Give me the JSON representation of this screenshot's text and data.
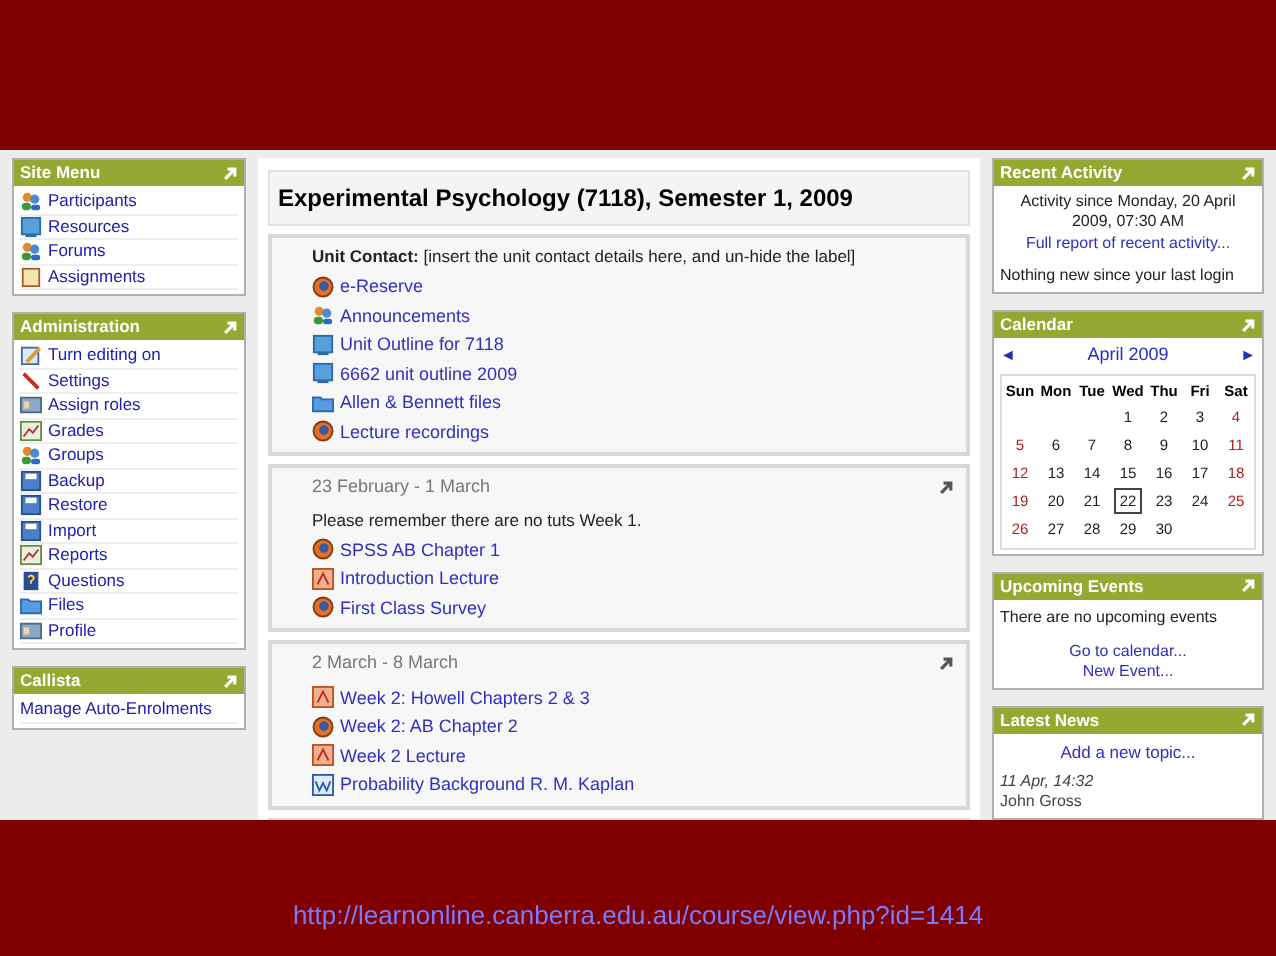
{
  "left_blocks": [
    {
      "title": "Site Menu",
      "items": [
        {
          "label": "Participants",
          "kind": "people"
        },
        {
          "label": "Resources",
          "kind": "page"
        },
        {
          "label": "Forums",
          "kind": "people"
        },
        {
          "label": "Assignments",
          "kind": "clipboard"
        }
      ]
    },
    {
      "title": "Administration",
      "items": [
        {
          "label": "Turn editing on",
          "kind": "edit"
        },
        {
          "label": "Settings",
          "kind": "pen"
        },
        {
          "label": "Assign roles",
          "kind": "card"
        },
        {
          "label": "Grades",
          "kind": "chart"
        },
        {
          "label": "Groups",
          "kind": "people"
        },
        {
          "label": "Backup",
          "kind": "disk"
        },
        {
          "label": "Restore",
          "kind": "disk"
        },
        {
          "label": "Import",
          "kind": "disk"
        },
        {
          "label": "Reports",
          "kind": "chart"
        },
        {
          "label": "Questions",
          "kind": "question"
        },
        {
          "label": "Files",
          "kind": "folder"
        },
        {
          "label": "Profile",
          "kind": "card"
        }
      ]
    },
    {
      "title": "Callista",
      "items": [
        {
          "label": "Manage Auto-Enrolments"
        }
      ]
    }
  ],
  "course_title": "Experimental Psychology (7118), Semester 1, 2009",
  "sections": [
    {
      "note": "**Unit Contact:** [insert the unit contact details here, and un-hide the label]",
      "items": [
        {
          "label": "e-Reserve",
          "kind": "globe"
        },
        {
          "label": "Announcements",
          "kind": "people"
        },
        {
          "label": "Unit Outline for 7118",
          "kind": "page"
        },
        {
          "label": "6662 unit outline 2009",
          "kind": "page"
        },
        {
          "label": "Allen & Bennett files",
          "kind": "folder"
        },
        {
          "label": "Lecture recordings",
          "kind": "globe"
        }
      ]
    },
    {
      "heading": "23 February - 1 March",
      "note": "Please remember there are no tuts Week 1.",
      "items": [
        {
          "label": "SPSS AB Chapter 1",
          "kind": "globe"
        },
        {
          "label": "Introduction Lecture",
          "kind": "slides"
        },
        {
          "label": "First Class Survey",
          "kind": "globe"
        }
      ]
    },
    {
      "heading": "2 March - 8 March",
      "items": [
        {
          "label": "Week 2: Howell Chapters 2 & 3",
          "kind": "slides"
        },
        {
          "label": "Week 2: AB Chapter 2",
          "kind": "globe"
        },
        {
          "label": "Week 2 Lecture",
          "kind": "slides"
        },
        {
          "label": "Probability Background R. M. Kaplan",
          "kind": "word"
        }
      ]
    }
  ],
  "recent_activity": {
    "title": "Recent Activity",
    "since": "Activity since Monday, 20 April 2009, 07:30 AM",
    "link": "Full report of recent activity...",
    "note": "Nothing new since your last login"
  },
  "calendar": {
    "title": "Calendar",
    "prev": "◄",
    "month": "April 2009",
    "next": "►",
    "weekdays": [
      "Sun",
      "Mon",
      "Tue",
      "Wed",
      "Thu",
      "Fri",
      "Sat"
    ],
    "weeks": [
      [
        {
          "kind": "blank"
        },
        {
          "kind": "blank"
        },
        {
          "kind": "blank"
        },
        {
          "day": "1",
          "weekend": false,
          "today": false
        },
        {
          "day": "2",
          "weekend": false,
          "today": false
        },
        {
          "day": "3",
          "weekend": false,
          "today": false
        },
        {
          "day": "4",
          "weekend": true,
          "today": false
        }
      ],
      [
        {
          "day": "5",
          "weekend": true,
          "today": false
        },
        {
          "day": "6",
          "weekend": false,
          "today": false
        },
        {
          "day": "7",
          "weekend": false,
          "today": false
        },
        {
          "day": "8",
          "weekend": false,
          "today": false
        },
        {
          "day": "9",
          "weekend": false,
          "today": false
        },
        {
          "day": "10",
          "weekend": false,
          "today": false
        },
        {
          "day": "11",
          "weekend": true,
          "today": false
        }
      ],
      [
        {
          "day": "12",
          "weekend": true,
          "today": false
        },
        {
          "day": "13",
          "weekend": false,
          "today": false
        },
        {
          "day": "14",
          "weekend": false,
          "today": false
        },
        {
          "day": "15",
          "weekend": false,
          "today": false
        },
        {
          "day": "16",
          "weekend": false,
          "today": false
        },
        {
          "day": "17",
          "weekend": false,
          "today": false
        },
        {
          "day": "18",
          "weekend": true,
          "today": false
        }
      ],
      [
        {
          "day": "19",
          "weekend": true,
          "today": false
        },
        {
          "day": "20",
          "weekend": false,
          "today": false
        },
        {
          "day": "21",
          "weekend": false,
          "today": false
        },
        {
          "day": "22",
          "weekend": false,
          "today": true
        },
        {
          "day": "23",
          "weekend": false,
          "today": false
        },
        {
          "day": "24",
          "weekend": false,
          "today": false
        },
        {
          "day": "25",
          "weekend": true,
          "today": false
        }
      ],
      [
        {
          "day": "26",
          "weekend": true,
          "today": false
        },
        {
          "day": "27",
          "weekend": false,
          "today": false
        },
        {
          "day": "28",
          "weekend": false,
          "today": false
        },
        {
          "day": "29",
          "weekend": false,
          "today": false
        },
        {
          "day": "30",
          "weekend": false,
          "today": false
        },
        {
          "kind": "blank"
        },
        {
          "kind": "blank"
        }
      ]
    ]
  },
  "upcoming_events": {
    "title": "Upcoming Events",
    "message": "There are no upcoming events",
    "links": [
      "Go to calendar...",
      "New Event..."
    ]
  },
  "latest_news": {
    "title": "Latest News",
    "link": "Add a new topic...",
    "date": "11 Apr, 14:32",
    "author": "John Gross"
  },
  "caption_url": "http://learnonline.canberra.edu.au/course/view.php?id=1414"
}
